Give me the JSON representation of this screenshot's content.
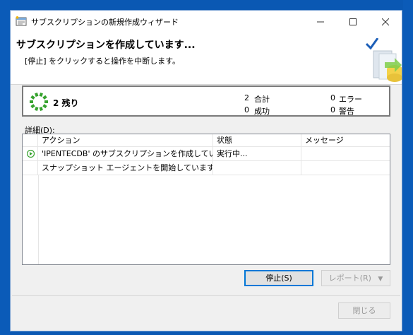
{
  "window": {
    "title": "サブスクリプションの新規作成ウィザード",
    "controls": {
      "minimize": "—",
      "maximize": "☐",
      "close": "✕"
    }
  },
  "header": {
    "heading": "サブスクリプションを作成しています...",
    "subheading": "[停止] をクリックすると操作を中断します。"
  },
  "summary": {
    "remaining": "2 残り",
    "total_count": "2",
    "total_label": "合計",
    "success_count": "0",
    "success_label": "成功",
    "error_count": "0",
    "error_label": "エラー",
    "warning_count": "0",
    "warning_label": "警告"
  },
  "details": {
    "label": "詳細(D):",
    "columns": [
      "アクション",
      "状態",
      "メッセージ"
    ],
    "rows": [
      {
        "action": "'IPENTECDB' のサブスクリプションを作成していま...",
        "status": "実行中...",
        "message": ""
      },
      {
        "action": "スナップショット エージェントを開始しています",
        "status": "",
        "message": ""
      }
    ]
  },
  "buttons": {
    "stop": "停止(S)",
    "report": "レポート(R)",
    "close": "閉じる"
  },
  "colors": {
    "accent": "#0078d7",
    "progress_green": "#36a22e",
    "desktop": "#0a58b3"
  }
}
